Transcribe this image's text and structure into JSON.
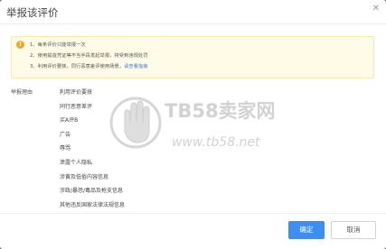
{
  "dialog": {
    "title": "举报该评价",
    "close_symbol": "✕"
  },
  "notice": {
    "icon": "warning-icon",
    "icon_glyph": "!",
    "line1": "1、每条评价只能举报一次",
    "line2": "2、使用提造凭证等不当手段发起举报，将受到违规处罚",
    "line3_prefix": "3、利用评价要挟，同行恶意差评使用场景，",
    "line3_link": "请查看指南"
  },
  "reasons": {
    "label": "举报理由",
    "items": [
      "利用评价要挟",
      "同行恶意差评",
      "买A评B",
      "广告",
      "辱骂",
      "泄露个人隐私",
      "涉黄及低俗内容信息",
      "涉政/暴恐/毒品及枪支信息",
      "其他违反国家法律法规信息"
    ]
  },
  "watermark": {
    "brand": "TB58卖家网",
    "url": "www.tb58.net"
  },
  "buttons": {
    "confirm": "确定",
    "cancel": "取消"
  },
  "colors": {
    "primary": "#3d8ef0",
    "warning": "#f5a623",
    "notice_bg": "#fffbe7",
    "watermark": "#cfcfcf"
  }
}
